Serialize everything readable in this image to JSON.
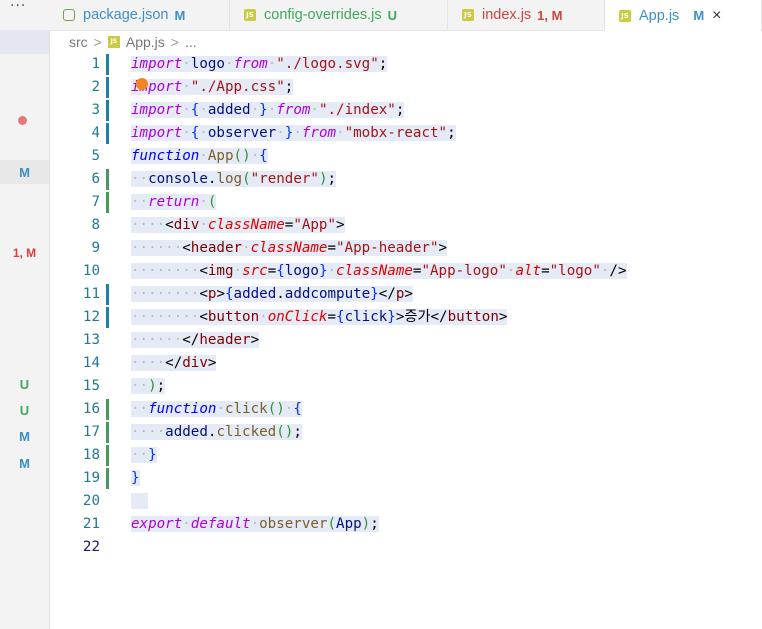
{
  "tabs": [
    {
      "label": "package.json",
      "status": "M",
      "icon": "node-icon"
    },
    {
      "label": "config-overrides.js",
      "status": "U",
      "icon": "js-icon"
    },
    {
      "label": "index.js",
      "status": "1, M",
      "icon": "js-icon"
    },
    {
      "label": "App.js",
      "status": "M",
      "icon": "js-icon",
      "active": true
    }
  ],
  "menu_label": "···",
  "close_glyph": "×",
  "breadcrumb": {
    "folder": "src",
    "file": "App.js",
    "more": "..."
  },
  "gutter_status": [
    {
      "text": "M",
      "kind": "modified"
    },
    {
      "text": "1, M",
      "kind": "error"
    },
    {
      "text": "U",
      "kind": "untracked"
    },
    {
      "text": "U",
      "kind": "untracked"
    },
    {
      "text": "M",
      "kind": "modified"
    },
    {
      "text": "M",
      "kind": "modified"
    }
  ],
  "editor": {
    "language": "javascript",
    "current_line": 22,
    "lines": [
      "import logo from \"./logo.svg\";",
      "import \"./App.css\";",
      "import { added } from \"./index\";",
      "import { observer } from \"mobx-react\";",
      "function App() {",
      "  console.log(\"render\");",
      "  return (",
      "    <div className=\"App\">",
      "      <header className=\"App-header\">",
      "        <img src={logo} className=\"App-logo\" alt=\"logo\" />",
      "        <p>{added.addcompute}</p>",
      "        <button onClick={click}>증가</button>",
      "      </header>",
      "    </div>",
      "  );",
      "  function click() {",
      "    added.clicked();",
      "  }",
      "}",
      "",
      "export default observer(App);",
      ""
    ]
  },
  "colors": {
    "keyword": "#0000ff",
    "string": "#a31515",
    "modified": "#3d8ec7",
    "untracked": "#3ea85b",
    "error": "#d1443c",
    "selection": "#e5ebf6"
  }
}
